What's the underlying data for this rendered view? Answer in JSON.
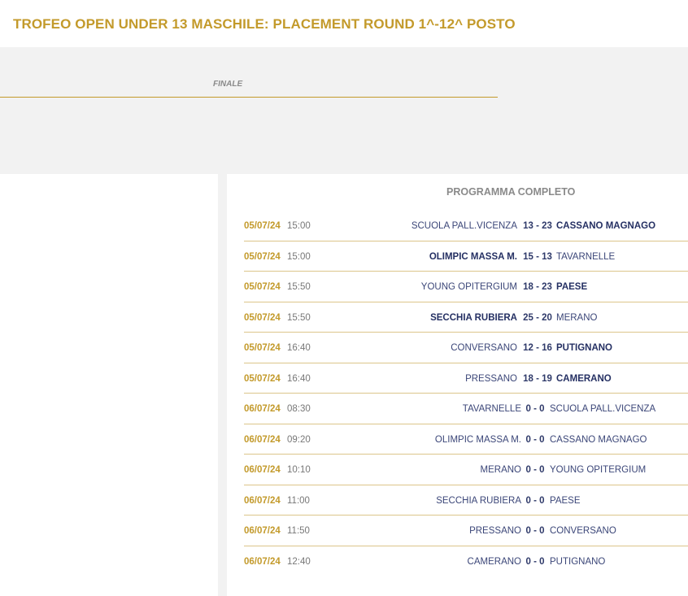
{
  "page_title": "TROFEO OPEN UNDER 13 MASCHILE: PLACEMENT ROUND 1^-12^ POSTO",
  "bracket": {
    "round_label": "FINALE"
  },
  "schedule": {
    "title": "PROGRAMMA COMPLETO",
    "matches": [
      {
        "date": "05/07/24",
        "time": "15:00",
        "home": "SCUOLA PALL.VICENZA",
        "score": "13 - 23",
        "away": "CASSANO MAGNAGO",
        "winner": "away"
      },
      {
        "date": "05/07/24",
        "time": "15:00",
        "home": "OLIMPIC MASSA M.",
        "score": "15 - 13",
        "away": "TAVARNELLE",
        "winner": "home"
      },
      {
        "date": "05/07/24",
        "time": "15:50",
        "home": "YOUNG OPITERGIUM",
        "score": "18 - 23",
        "away": "PAESE",
        "winner": "away"
      },
      {
        "date": "05/07/24",
        "time": "15:50",
        "home": "SECCHIA RUBIERA",
        "score": "25 - 20",
        "away": "MERANO",
        "winner": "home"
      },
      {
        "date": "05/07/24",
        "time": "16:40",
        "home": "CONVERSANO",
        "score": "12 - 16",
        "away": "PUTIGNANO",
        "winner": "away"
      },
      {
        "date": "05/07/24",
        "time": "16:40",
        "home": "PRESSANO",
        "score": "18 - 19",
        "away": "CAMERANO",
        "winner": "away"
      },
      {
        "date": "06/07/24",
        "time": "08:30",
        "home": "TAVARNELLE",
        "score": "0 - 0",
        "away": "SCUOLA PALL.VICENZA",
        "winner": ""
      },
      {
        "date": "06/07/24",
        "time": "09:20",
        "home": "OLIMPIC MASSA M.",
        "score": "0 - 0",
        "away": "CASSANO MAGNAGO",
        "winner": ""
      },
      {
        "date": "06/07/24",
        "time": "10:10",
        "home": "MERANO",
        "score": "0 - 0",
        "away": "YOUNG OPITERGIUM",
        "winner": ""
      },
      {
        "date": "06/07/24",
        "time": "11:00",
        "home": "SECCHIA RUBIERA",
        "score": "0 - 0",
        "away": "PAESE",
        "winner": ""
      },
      {
        "date": "06/07/24",
        "time": "11:50",
        "home": "PRESSANO",
        "score": "0 - 0",
        "away": "CONVERSANO",
        "winner": ""
      },
      {
        "date": "06/07/24",
        "time": "12:40",
        "home": "CAMERANO",
        "score": "0 - 0",
        "away": "PUTIGNANO",
        "winner": ""
      }
    ]
  },
  "colors": {
    "accent": "#c39a2b",
    "team": "#3b4678",
    "panel": "#f2f2f2"
  }
}
